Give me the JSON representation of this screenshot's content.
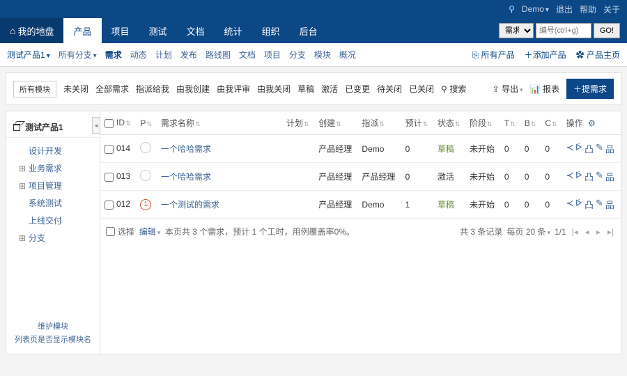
{
  "header": {
    "user_icon": "⚲",
    "user": "Demo",
    "logout": "退出",
    "help": "帮助",
    "about": "关于"
  },
  "nav": {
    "home": "我的地盘",
    "tabs": [
      "产品",
      "项目",
      "测试",
      "文档",
      "统计",
      "组织",
      "后台"
    ],
    "active_index": 0,
    "search_type": "需求",
    "search_placeholder": "编号(ctrl+g)",
    "go": "GO!"
  },
  "subnav": {
    "product": "测试产品1",
    "branch": "所有分支",
    "items": [
      "需求",
      "动态",
      "计划",
      "发布",
      "路线图",
      "文档",
      "项目",
      "分支",
      "模块",
      "概况"
    ],
    "active_index": 0,
    "right": {
      "all_products": "所有产品",
      "add_product": "添加产品",
      "product_home": "产品主页"
    }
  },
  "toolbar": {
    "module_btn": "所有模块",
    "filters": [
      "未关闭",
      "全部需求",
      "指派给我",
      "由我创建",
      "由我评审",
      "由我关闭",
      "草稿",
      "激活",
      "已变更",
      "待关闭",
      "已关闭"
    ],
    "search_icon": "⚲",
    "search_label": "搜索",
    "export": "导出",
    "report": "报表",
    "create": "提需求"
  },
  "sidebar": {
    "title": "测试产品1",
    "tree": [
      {
        "label": "设计开发",
        "exp": ""
      },
      {
        "label": "业务需求",
        "exp": "⊞"
      },
      {
        "label": "项目管理",
        "exp": "⊞"
      },
      {
        "label": "系统测试",
        "exp": ""
      },
      {
        "label": "上线交付",
        "exp": ""
      },
      {
        "label": "分支",
        "exp": "⊞"
      }
    ],
    "maintain": "维护模块",
    "show_module": "列表页是否显示模块名"
  },
  "table": {
    "headers": {
      "id": "ID",
      "p": "P",
      "name": "需求名称",
      "plan": "计划",
      "create": "创建",
      "assign": "指派",
      "est": "预计",
      "status": "状态",
      "stage": "阶段",
      "t": "T",
      "b": "B",
      "c": "C",
      "ops": "操作"
    },
    "rows": [
      {
        "id": "014",
        "pri": "",
        "pri_red": false,
        "name": "一个哈哈需求",
        "plan": "",
        "create": "产品经理",
        "assign": "Demo",
        "est": "0",
        "status": "草稿",
        "status_cls": "draft",
        "stage": "未开始",
        "t": "0",
        "b": "0",
        "c": "0"
      },
      {
        "id": "013",
        "pri": "",
        "pri_red": false,
        "name": "一个哈哈需求",
        "plan": "",
        "create": "产品经理",
        "assign": "产品经理",
        "est": "0",
        "status": "激活",
        "status_cls": "active",
        "stage": "未开始",
        "t": "0",
        "b": "0",
        "c": "0"
      },
      {
        "id": "012",
        "pri": "1",
        "pri_red": true,
        "name": "一个测试的需求",
        "plan": "",
        "create": "产品经理",
        "assign": "Demo",
        "est": "1",
        "status": "草稿",
        "status_cls": "draft",
        "stage": "未开始",
        "t": "0",
        "b": "0",
        "c": "0"
      }
    ],
    "footer": {
      "select": "选择",
      "edit": "编辑",
      "summary": "本页共 3 个需求，预计 1 个工时，用例覆盖率0%。",
      "total": "共 3 条记录",
      "per_page": "每页 20 条",
      "page": "1/1"
    }
  }
}
